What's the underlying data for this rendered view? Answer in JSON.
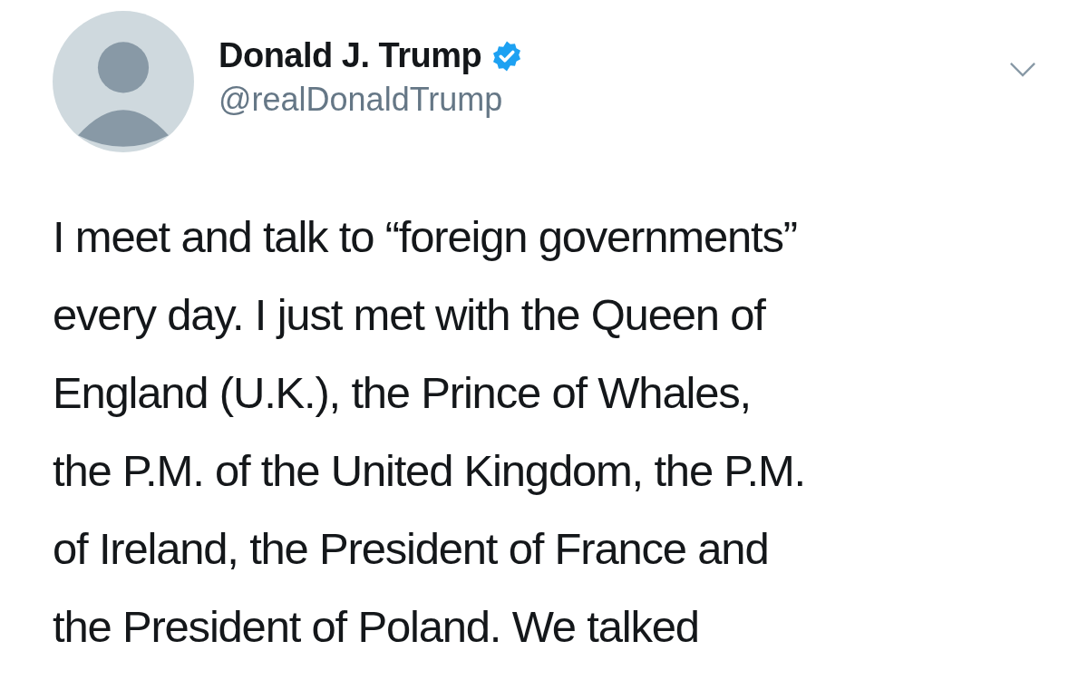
{
  "tweet": {
    "author": {
      "name": "Donald J. Trump",
      "verified": true,
      "handle": "@realDonaldTrump"
    },
    "text_lines": [
      "I meet and talk to “foreign governments”",
      "every day. I just met with the Queen of",
      "England (U.K.), the Prince of Whales,",
      "the P.M. of the United Kingdom, the P.M.",
      "of Ireland, the President of France and",
      "the President of Poland. We talked"
    ]
  }
}
